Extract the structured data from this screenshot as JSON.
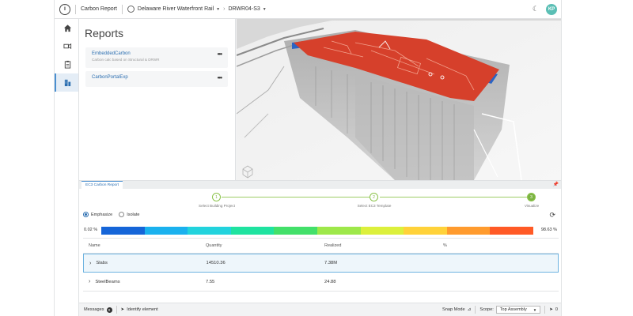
{
  "topbar": {
    "app_title": "Carbon Report",
    "project": "Delaware River Waterfront Rail",
    "model": "DRWR04-S3",
    "avatar_initials": "KP"
  },
  "reports": {
    "title": "Reports",
    "items": [
      {
        "name": "EmbeddedCarbon",
        "description": "Carbon calc based on Structural & DRWR",
        "menu": "•••"
      },
      {
        "name": "CarbonPortalExp",
        "description": "",
        "menu": "•••"
      }
    ]
  },
  "widget": {
    "tab": "EC3 Carbon Report",
    "steps": [
      {
        "number": "1",
        "label": "Select Building Project"
      },
      {
        "number": "2",
        "label": "Select EC3 Template"
      },
      {
        "number": "3",
        "label": "Visualize"
      }
    ],
    "display_modes": [
      "Emphasize",
      "Isolate"
    ],
    "selected_mode": "Emphasize",
    "scale_min": "0.02 %",
    "scale_max": "98.63 %",
    "scale_colors": [
      "#1565d8",
      "#1ab1ee",
      "#22d3dd",
      "#1fe3a0",
      "#43e06a",
      "#9ee84a",
      "#dcf03c",
      "#ffd23a",
      "#ff9b2e",
      "#ff5a26"
    ],
    "table": {
      "headers": [
        "Name",
        "Quantity",
        "Realized",
        "%"
      ],
      "rows": [
        {
          "name": "Slabs",
          "quantity": "14510.36",
          "realized": "7.38M",
          "percent": ""
        },
        {
          "name": "SteelBeams",
          "quantity": "7.55",
          "realized": "24.88",
          "percent": ""
        }
      ]
    }
  },
  "statusbar": {
    "messages_label": "Messages",
    "messages_count": "0",
    "identify_label": "Identify element",
    "snap_label": "Snap Mode",
    "scope_label": "Scope:",
    "scope_value": "Top Assembly",
    "selection_count": "0"
  },
  "colors": {
    "accent": "#2c6fb1",
    "step_green": "#7cb342",
    "model_red": "#d6402b",
    "model_blue": "#2a64c4"
  }
}
